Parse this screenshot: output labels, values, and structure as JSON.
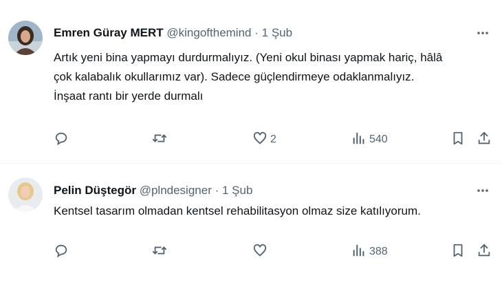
{
  "tweets": [
    {
      "name": "Emren Güray MERT",
      "handle": "@kingofthemind",
      "separator": "·",
      "date": "1 Şub",
      "lines": [
        "Artık yeni bina yapmayı durdurmalıyız. (Yeni okul binası yapmak hariç, hâlâ",
        "çok kalabalık okullarımız var). Sadece güçlendirmeye odaklanmalıyız.",
        "İnşaat rantı bir yerde durmalı"
      ],
      "likes": "2",
      "views": "540"
    },
    {
      "name": "Pelin Düştegör",
      "handle": "@plndesigner",
      "separator": "·",
      "date": "1 Şub",
      "lines": [
        "Kentsel tasarım olmadan kentsel rehabilitasyon olmaz size katılıyorum."
      ],
      "likes": "",
      "views": "388"
    }
  ],
  "icons": {
    "more": "more-icon",
    "reply": "reply-icon",
    "retweet": "retweet-icon",
    "like": "heart-icon",
    "views": "views-icon",
    "bookmark": "bookmark-icon",
    "share": "share-icon"
  },
  "colors": {
    "text": "#0f1419",
    "muted": "#536471",
    "divider": "#eff3f4"
  }
}
